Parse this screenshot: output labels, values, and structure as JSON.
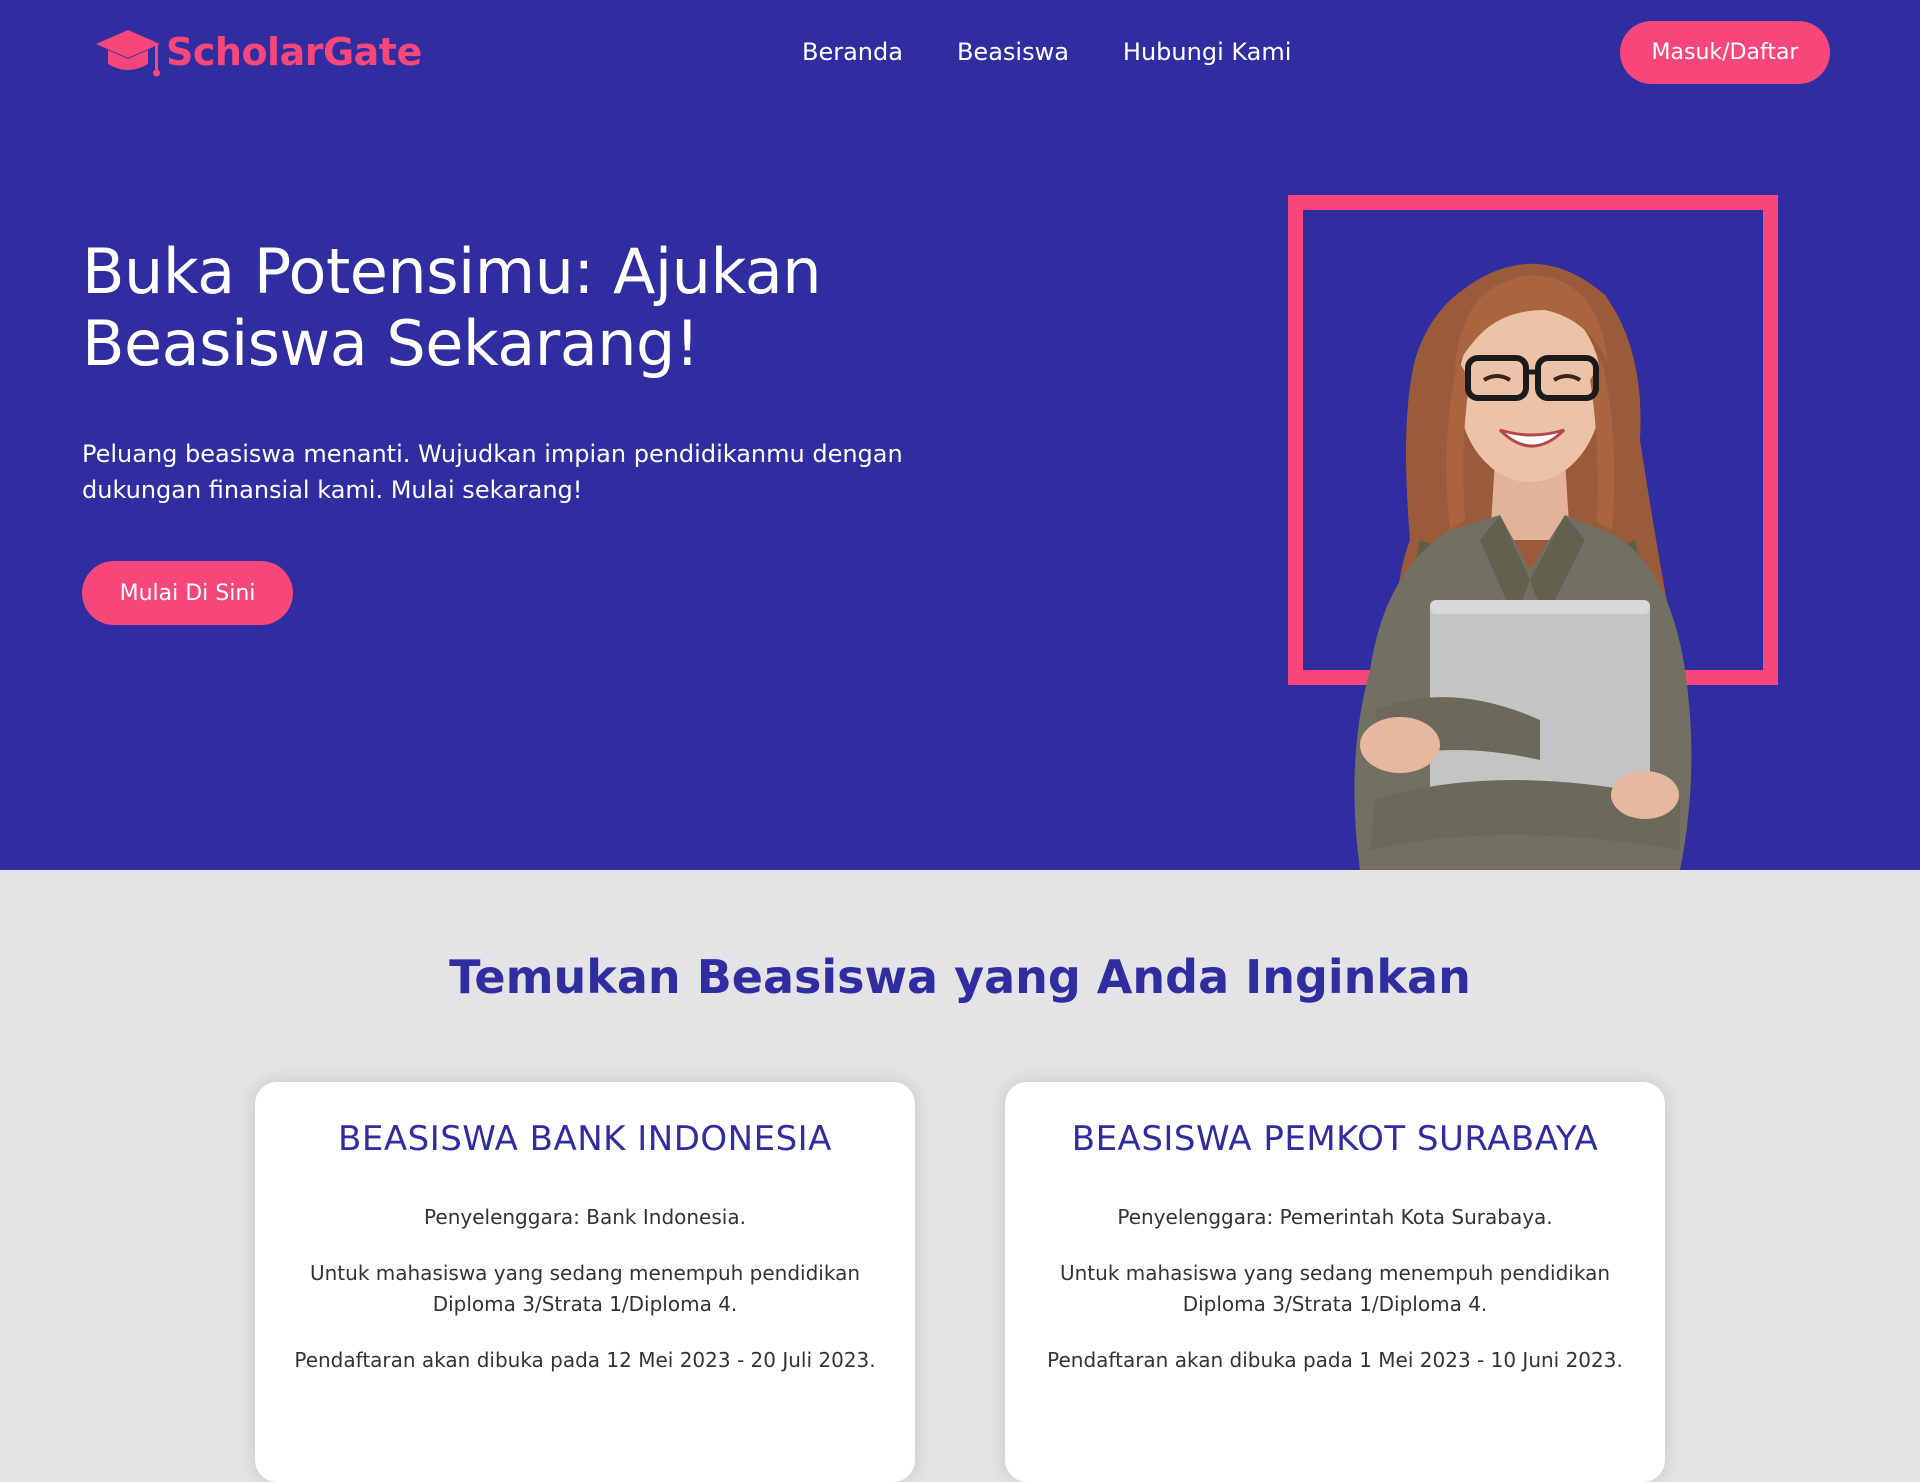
{
  "brand": {
    "name": "ScholarGate",
    "icon": "graduation-cap-icon",
    "color": "#f7467a"
  },
  "nav": {
    "items": [
      {
        "label": "Beranda"
      },
      {
        "label": "Beasiswa"
      },
      {
        "label": "Hubungi Kami"
      }
    ],
    "login_label": "Masuk/Daftar"
  },
  "hero": {
    "title": "Buka Potensimu: Ajukan Beasiswa Sekarang!",
    "subtitle": "Peluang beasiswa menanti. Wujudkan impian pendidikanmu dengan dukungan finansial kami. Mulai sekarang!",
    "cta_label": "Mulai Di Sini",
    "background": "#2f2d9f"
  },
  "listing": {
    "heading": "Temukan Beasiswa yang Anda Inginkan",
    "cards": [
      {
        "title": "BEASISWA BANK INDONESIA",
        "organizer": "Penyelenggara: Bank Indonesia.",
        "description": "Untuk mahasiswa yang sedang menempuh pendidikan Diploma 3/Strata 1/Diploma 4.",
        "registration": "Pendaftaran akan dibuka pada 12 Mei 2023 - 20 Juli 2023."
      },
      {
        "title": "BEASISWA PEMKOT SURABAYA",
        "organizer": "Penyelenggara: Pemerintah Kota Surabaya.",
        "description": "Untuk mahasiswa yang sedang menempuh pendidikan Diploma 3/Strata 1/Diploma 4.",
        "registration": "Pendaftaran akan dibuka pada 1 Mei 2023 - 10 Juni 2023."
      }
    ]
  }
}
